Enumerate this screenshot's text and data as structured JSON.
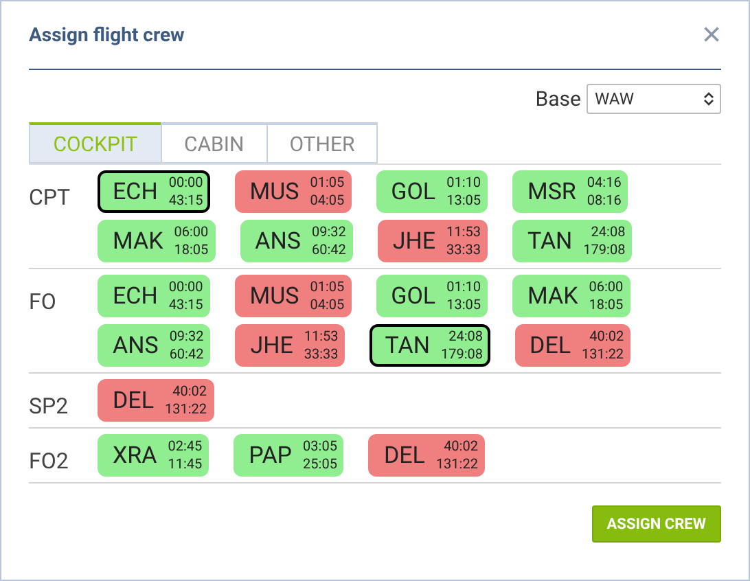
{
  "dialog": {
    "title": "Assign flight crew",
    "close": "×"
  },
  "base": {
    "label": "Base",
    "value": "WAW"
  },
  "tabs": [
    {
      "label": "COCKPIT",
      "selected": true
    },
    {
      "label": "CABIN",
      "selected": false
    },
    {
      "label": "OTHER",
      "selected": false
    }
  ],
  "positions": [
    {
      "label": "CPT",
      "crew": [
        {
          "code": "ECH",
          "time_1": "00:00",
          "time_2": "43:15",
          "color": "#90ee90",
          "selected": true
        },
        {
          "code": "MUS",
          "time_1": "01:05",
          "time_2": "04:05",
          "color": "#f08080",
          "selected": false
        },
        {
          "code": "GOL",
          "time_1": "01:10",
          "time_2": "13:05",
          "color": "#90ee90",
          "selected": false
        },
        {
          "code": "MSR",
          "time_1": "04:16",
          "time_2": "08:16",
          "color": "#90ee90",
          "selected": false
        },
        {
          "code": "MAK",
          "time_1": "06:00",
          "time_2": "18:05",
          "color": "#90ee90",
          "selected": false
        },
        {
          "code": "ANS",
          "time_1": "09:32",
          "time_2": "60:42",
          "color": "#90ee90",
          "selected": false
        },
        {
          "code": "JHE",
          "time_1": "11:53",
          "time_2": "33:33",
          "color": "#f08080",
          "selected": false
        },
        {
          "code": "TAN",
          "time_1": "24:08",
          "time_2": "179:08",
          "color": "#90ee90",
          "selected": false
        }
      ]
    },
    {
      "label": "FO",
      "crew": [
        {
          "code": "ECH",
          "time_1": "00:00",
          "time_2": "43:15",
          "color": "#90ee90",
          "selected": false
        },
        {
          "code": "MUS",
          "time_1": "01:05",
          "time_2": "04:05",
          "color": "#f08080",
          "selected": false
        },
        {
          "code": "GOL",
          "time_1": "01:10",
          "time_2": "13:05",
          "color": "#90ee90",
          "selected": false
        },
        {
          "code": "MAK",
          "time_1": "06:00",
          "time_2": "18:05",
          "color": "#90ee90",
          "selected": false
        },
        {
          "code": "ANS",
          "time_1": "09:32",
          "time_2": "60:42",
          "color": "#90ee90",
          "selected": false
        },
        {
          "code": "JHE",
          "time_1": "11:53",
          "time_2": "33:33",
          "color": "#f08080",
          "selected": false
        },
        {
          "code": "TAN",
          "time_1": "24:08",
          "time_2": "179:08",
          "color": "#90ee90",
          "selected": true
        },
        {
          "code": "DEL",
          "time_1": "40:02",
          "time_2": "131:22",
          "color": "#f08080",
          "selected": false
        }
      ]
    },
    {
      "label": "SP2",
      "crew": [
        {
          "code": "DEL",
          "time_1": "40:02",
          "time_2": "131:22",
          "color": "#f08080",
          "selected": false
        }
      ]
    },
    {
      "label": "FO2",
      "crew": [
        {
          "code": "XRA",
          "time_1": "02:45",
          "time_2": "11:45",
          "color": "#90ee90",
          "selected": false
        },
        {
          "code": "PAP",
          "time_1": "03:05",
          "time_2": "25:05",
          "color": "#90ee90",
          "selected": false
        },
        {
          "code": "DEL",
          "time_1": "40:02",
          "time_2": "131:22",
          "color": "#f08080",
          "selected": false
        }
      ]
    }
  ],
  "assign_button": "ASSIGN CREW"
}
